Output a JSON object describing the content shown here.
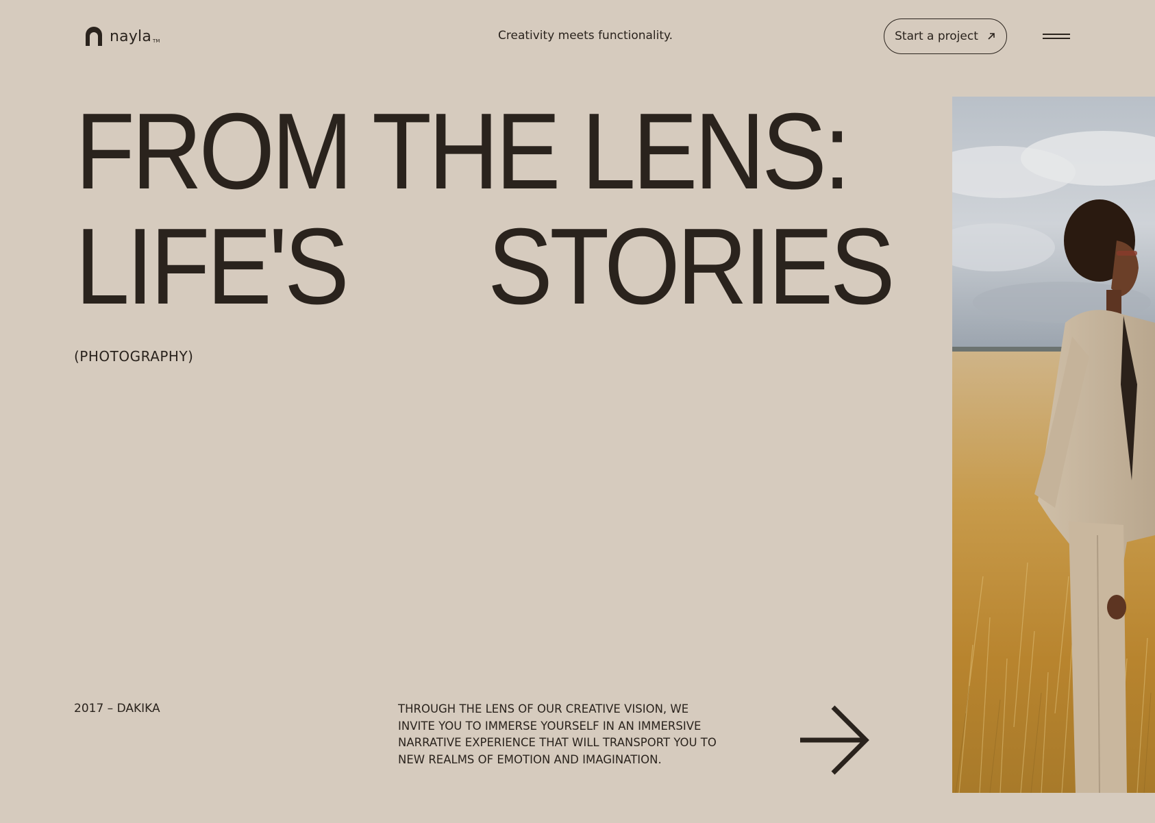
{
  "brand": {
    "name": "nayla",
    "tm": "TM"
  },
  "header": {
    "tagline": "Creativity meets functionality.",
    "cta_label": "Start a project"
  },
  "hero": {
    "line1": "FROM THE LENS:",
    "line2_left": "LIFE'S",
    "line2_right": "STORIES",
    "category": "(PHOTOGRAPHY)"
  },
  "footer": {
    "year_place": "2017 – DAKIKA",
    "description": "THROUGH THE LENS OF OUR CREATIVE VISION, WE INVITE YOU TO IMMERSE YOURSELF IN AN IMMERSIVE NARRATIVE EXPERIENCE THAT WILL TRANSPORT YOU TO NEW REALMS OF EMOTION AND IMAGINATION."
  },
  "icons": {
    "logo": "arch-logo-icon",
    "cta": "arrow-up-right-icon",
    "menu": "hamburger-menu-icon",
    "next": "arrow-right-icon"
  },
  "colors": {
    "background": "#d6cbbe",
    "text": "#2a231d"
  }
}
